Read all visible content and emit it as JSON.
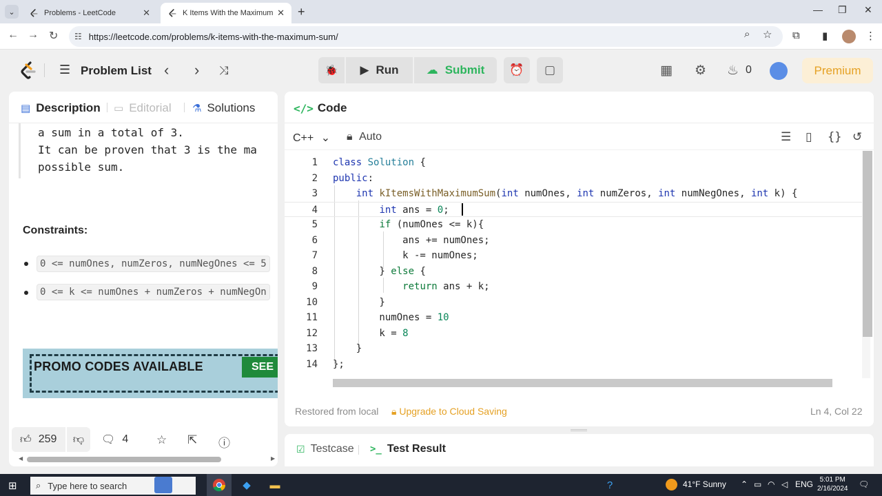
{
  "browser": {
    "tabs": [
      {
        "title": "Problems - LeetCode",
        "active": false
      },
      {
        "title": "K Items With the Maximum Sum",
        "active": true
      }
    ],
    "url": "https://leetcode.com/problems/k-items-with-the-maximum-sum/"
  },
  "header": {
    "problem_list": "Problem List",
    "run": "Run",
    "submit": "Submit",
    "streak": "0",
    "premium": "Premium"
  },
  "left_panel": {
    "tabs": [
      "Description",
      "Editorial",
      "Solutions"
    ],
    "explanation_lines": [
      "a sum in a total of 3.",
      "It can be proven that 3 is the ma",
      "possible sum."
    ],
    "constraints_heading": "Constraints:",
    "constraints": [
      "0 <= numOnes, numZeros, numNegOnes <= 5",
      "0 <= k <= numOnes + numZeros + numNegOn"
    ],
    "promo_text": "PROMO CODES AVAILABLE",
    "promo_button": "SEE",
    "likes": "259",
    "comments": "4"
  },
  "code_panel": {
    "title": "Code",
    "language": "C++",
    "mode": "Auto",
    "lines": [
      {
        "n": "1",
        "html": "<span class=\"kw\">class</span> <span class=\"cls\">Solution</span> {"
      },
      {
        "n": "2",
        "html": "<span class=\"kw\">public</span>:"
      },
      {
        "n": "3",
        "html": "    <span class=\"kw\">int</span> <span class=\"fn\">kItemsWithMaximumSum</span>(<span class=\"kw\">int</span> numOnes, <span class=\"kw\">int</span> numZeros, <span class=\"kw\">int</span> numNegOnes, <span class=\"kw\">int</span> k) {"
      },
      {
        "n": "4",
        "html": "        <span class=\"kw\">int</span> ans = <span class=\"num\">0</span>;"
      },
      {
        "n": "5",
        "html": "        <span class=\"kw2\">if</span> (numOnes &lt;= k){"
      },
      {
        "n": "6",
        "html": "            ans += numOnes;"
      },
      {
        "n": "7",
        "html": "            k -= numOnes;"
      },
      {
        "n": "8",
        "html": "        } <span class=\"kw2\">else</span> {"
      },
      {
        "n": "9",
        "html": "            <span class=\"kw2\">return</span> ans + k;"
      },
      {
        "n": "10",
        "html": "        }"
      },
      {
        "n": "11",
        "html": "        numOnes = <span class=\"num\">10</span>"
      },
      {
        "n": "12",
        "html": "        k = <span class=\"num\">8</span>"
      },
      {
        "n": "13",
        "html": "    }"
      },
      {
        "n": "14",
        "html": "};"
      }
    ],
    "status_restored": "Restored from local",
    "status_upgrade": "Upgrade to Cloud Saving",
    "cursor_position": "Ln 4, Col 22"
  },
  "test_panel": {
    "tabs": [
      "Testcase",
      "Test Result"
    ]
  },
  "taskbar": {
    "search_placeholder": "Type here to search",
    "weather": "41°F  Sunny",
    "language": "ENG",
    "time": "5:01 PM",
    "date": "2/16/2024"
  },
  "colors": {
    "accent_green": "#2db55d",
    "premium_orange": "#e5a124",
    "keyword_blue": "#1e36b0"
  }
}
